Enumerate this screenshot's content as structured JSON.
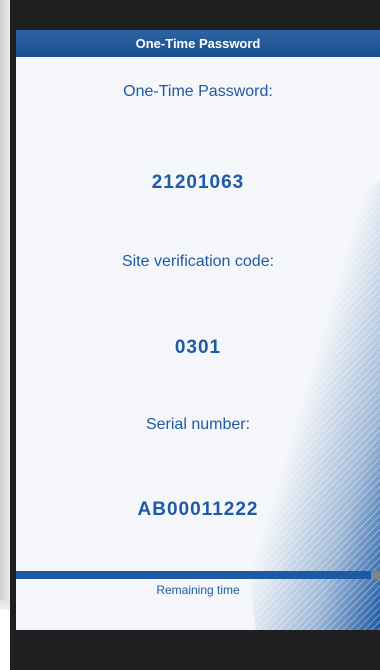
{
  "header": {
    "title": "One-Time Password"
  },
  "otp": {
    "label": "One-Time Password:",
    "value": "21201063"
  },
  "site_code": {
    "label": "Site verification code:",
    "value": "0301"
  },
  "serial": {
    "label": "Serial number:",
    "value": "AB00011222"
  },
  "remaining": {
    "label": "Remaining time",
    "fraction": 0.975
  },
  "colors": {
    "accent": "#1e5aa5",
    "title_bar": "#1f5394",
    "frame": "#1f1f22"
  }
}
